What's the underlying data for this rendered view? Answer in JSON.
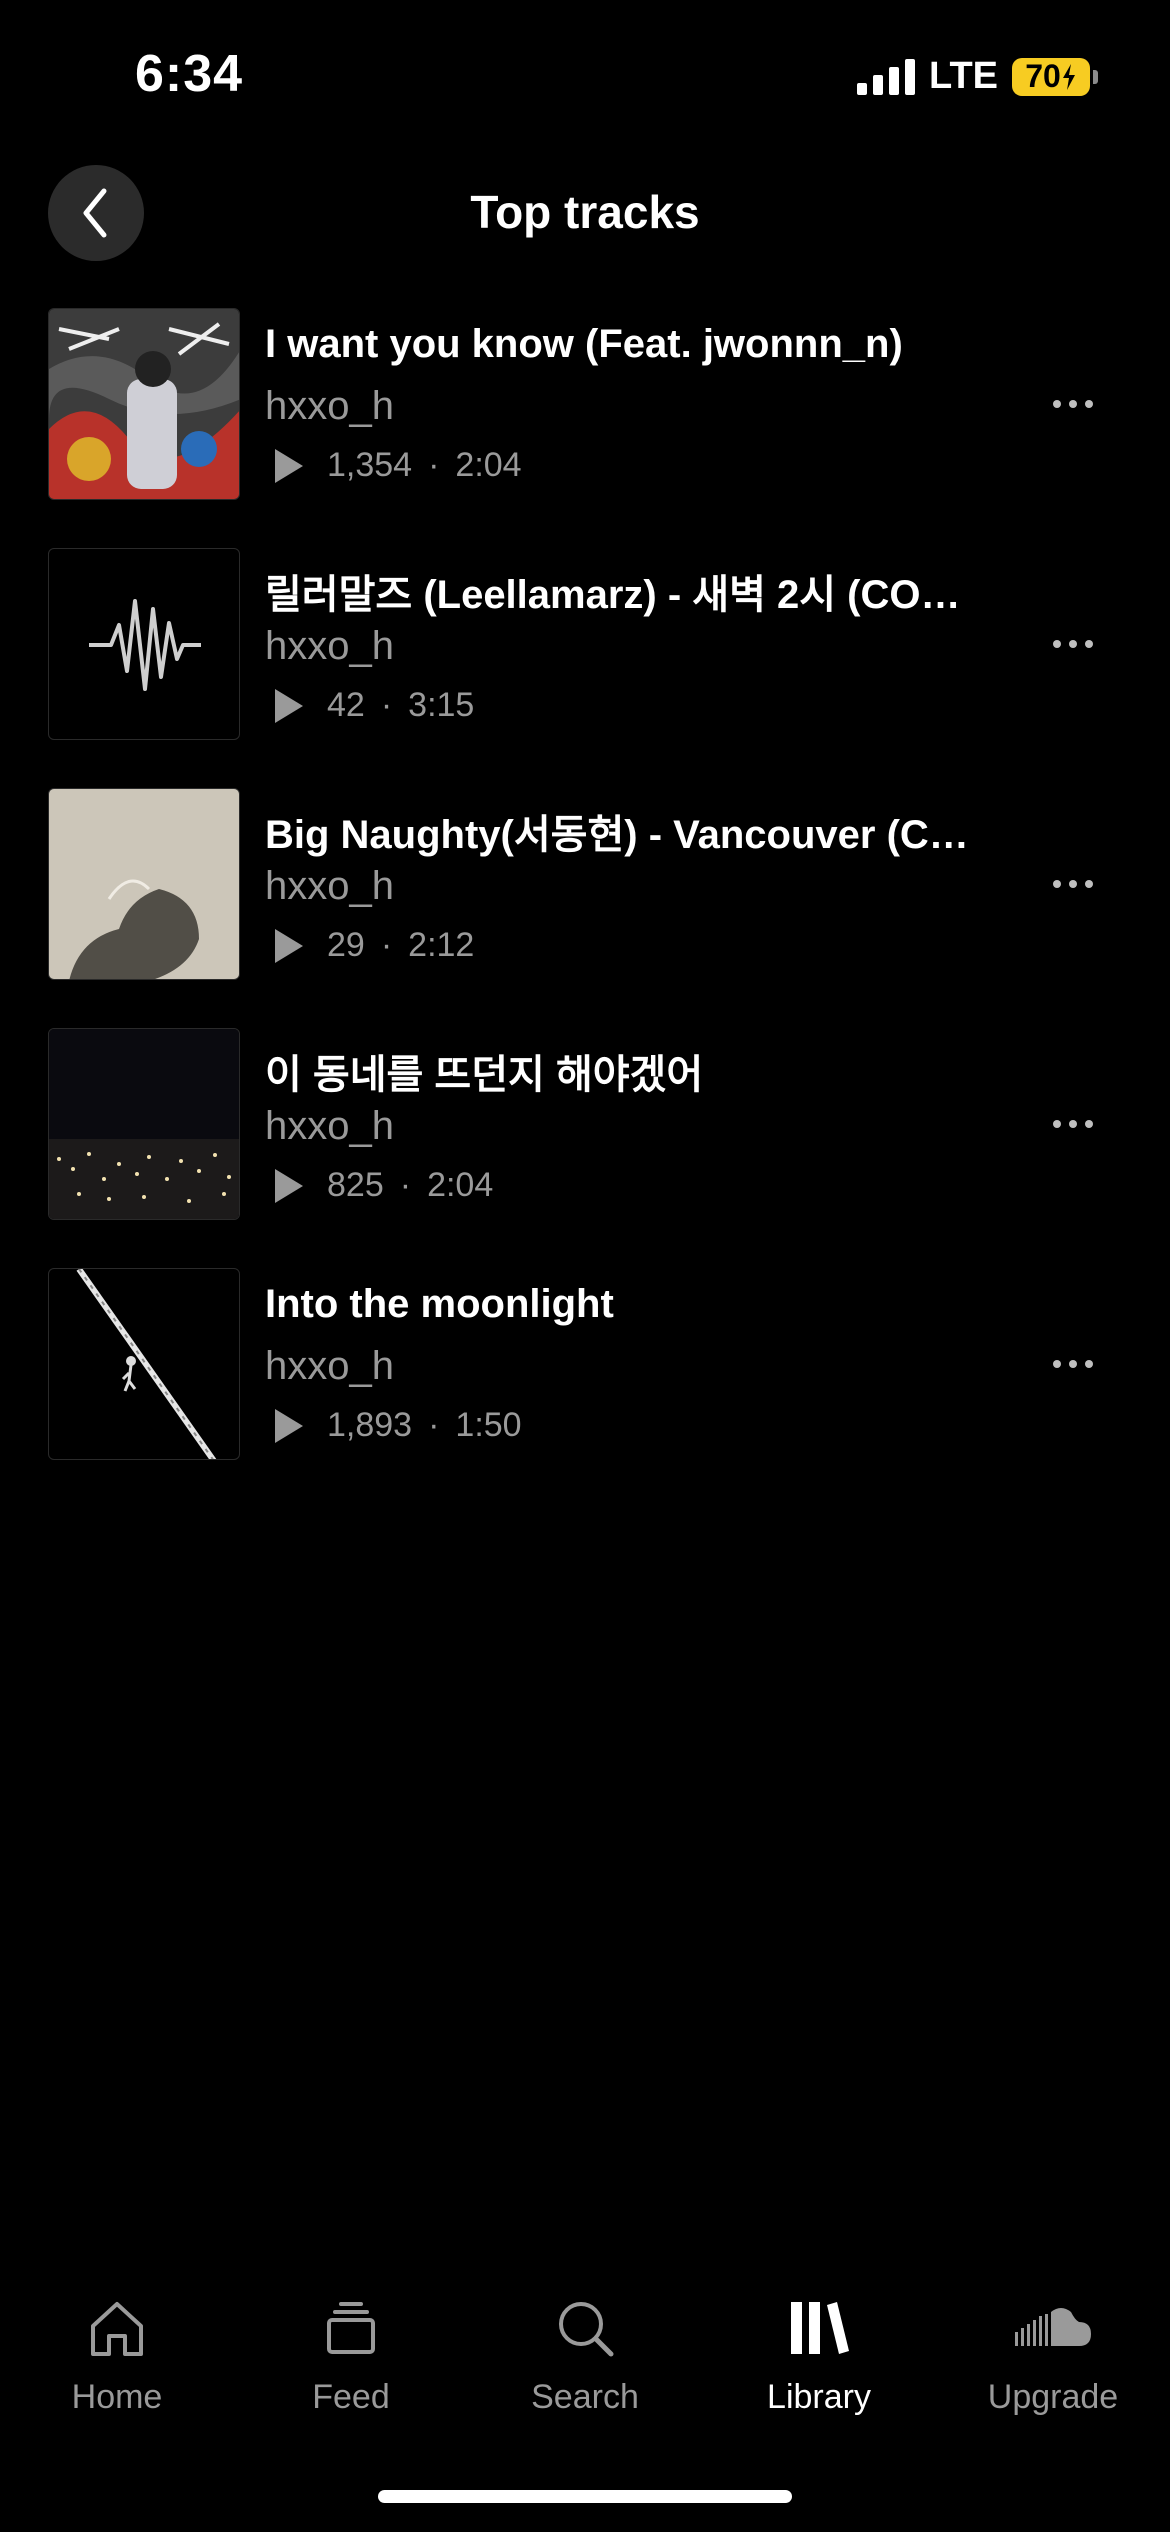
{
  "status_bar": {
    "time": "6:34",
    "network": "LTE",
    "battery": "70"
  },
  "header": {
    "title": "Top tracks"
  },
  "tracks": [
    {
      "title": "I want you know (Feat. jwonnn_n)",
      "artist": "hxxo_h",
      "plays": "1,354",
      "duration": "2:04"
    },
    {
      "title": "릴러말즈 (Leellamarz) - 새벽 2시 (COV…",
      "artist": "hxxo_h",
      "plays": "42",
      "duration": "3:15"
    },
    {
      "title": "Big Naughty(서동현) - Vancouver (C…",
      "artist": "hxxo_h",
      "plays": "29",
      "duration": "2:12"
    },
    {
      "title": "이 동네를 뜨던지 해야겠어",
      "artist": "hxxo_h",
      "plays": "825",
      "duration": "2:04"
    },
    {
      "title": "Into the moonlight",
      "artist": "hxxo_h",
      "plays": "1,893",
      "duration": "1:50"
    }
  ],
  "tab_bar": {
    "tabs": [
      {
        "label": "Home",
        "icon": "home-icon"
      },
      {
        "label": "Feed",
        "icon": "feed-icon"
      },
      {
        "label": "Search",
        "icon": "search-icon"
      },
      {
        "label": "Library",
        "icon": "library-icon",
        "active": true
      },
      {
        "label": "Upgrade",
        "icon": "cloud-icon"
      }
    ]
  },
  "colors": {
    "background": "#000000",
    "battery": "#f7cc22",
    "secondary_text": "#9a9a9a"
  }
}
